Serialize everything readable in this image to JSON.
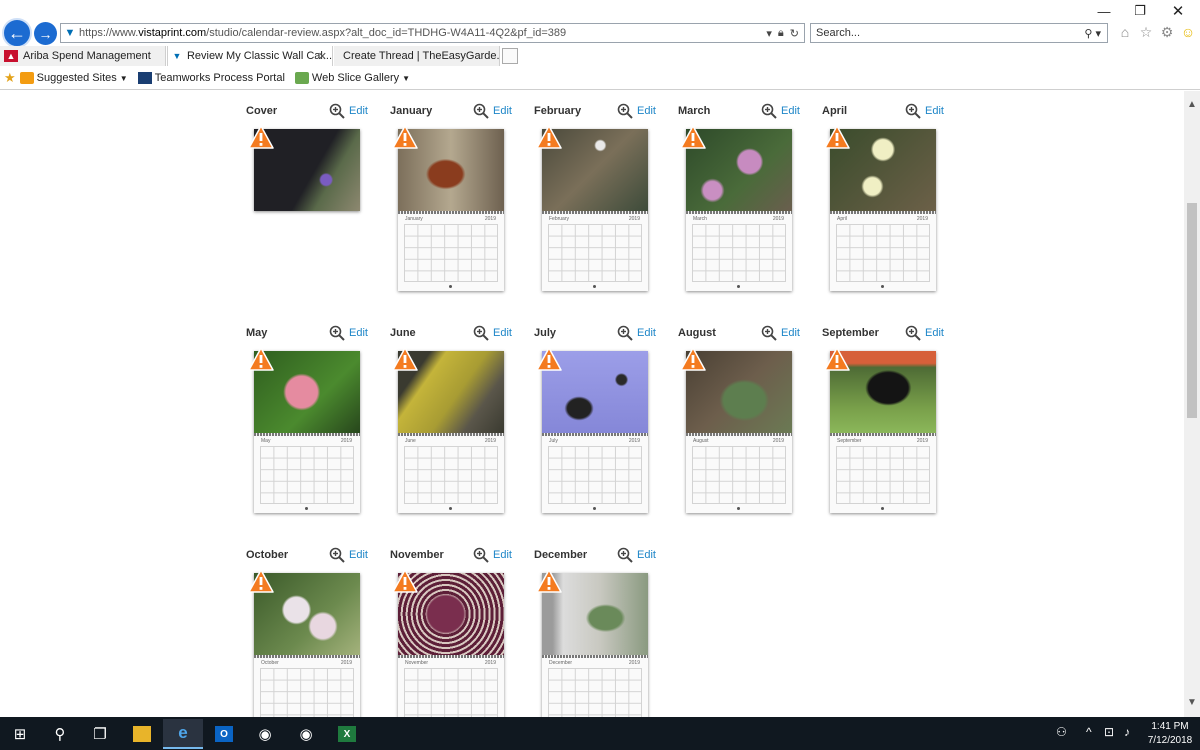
{
  "window": {
    "minimize": "—",
    "restore": "❐",
    "close": "✕"
  },
  "address": {
    "url_prefix": "https://www.",
    "url_domain": "vistaprint.com",
    "url_path": "/studio/calendar-review.aspx?alt_doc_id=THDHG-W4A11-4Q2&pf_id=389"
  },
  "search": {
    "placeholder": "Search..."
  },
  "tabs": [
    {
      "label": "Ariba Spend Management",
      "active": false
    },
    {
      "label": "Review My Classic Wall Cal...",
      "active": true
    },
    {
      "label": "Create Thread | TheEasyGarde...",
      "active": false
    }
  ],
  "favorites": [
    {
      "label": "Suggested Sites"
    },
    {
      "label": "Teamworks Process Portal"
    },
    {
      "label": "Web Slice Gallery"
    }
  ],
  "calendar": {
    "year": "2019",
    "edit_label": "Edit",
    "pages": [
      {
        "name": "Cover",
        "photo": "black cat with purple flower",
        "cover": true
      },
      {
        "name": "January",
        "photo": "chickens"
      },
      {
        "name": "February",
        "photo": "white flower on leaf litter"
      },
      {
        "name": "March",
        "photo": "pink hellebore flowers"
      },
      {
        "name": "April",
        "photo": "white blossoms"
      },
      {
        "name": "May",
        "photo": "pink daylily"
      },
      {
        "name": "June",
        "photo": "yellow lichen on rock"
      },
      {
        "name": "July",
        "photo": "plant silhouettes on lavender"
      },
      {
        "name": "August",
        "photo": "green plant"
      },
      {
        "name": "September",
        "photo": "black cow in field"
      },
      {
        "name": "October",
        "photo": "white blossoms"
      },
      {
        "name": "November",
        "photo": "pine cone"
      },
      {
        "name": "December",
        "photo": "leaves against wall"
      }
    ]
  },
  "taskbar": {
    "time": "1:41 PM",
    "date": "7/12/2018"
  },
  "colors": {
    "accent": "#1e86c8",
    "warning": "#f47b20",
    "ie_blue": "#1c6bd1",
    "taskbar": "#101820"
  }
}
